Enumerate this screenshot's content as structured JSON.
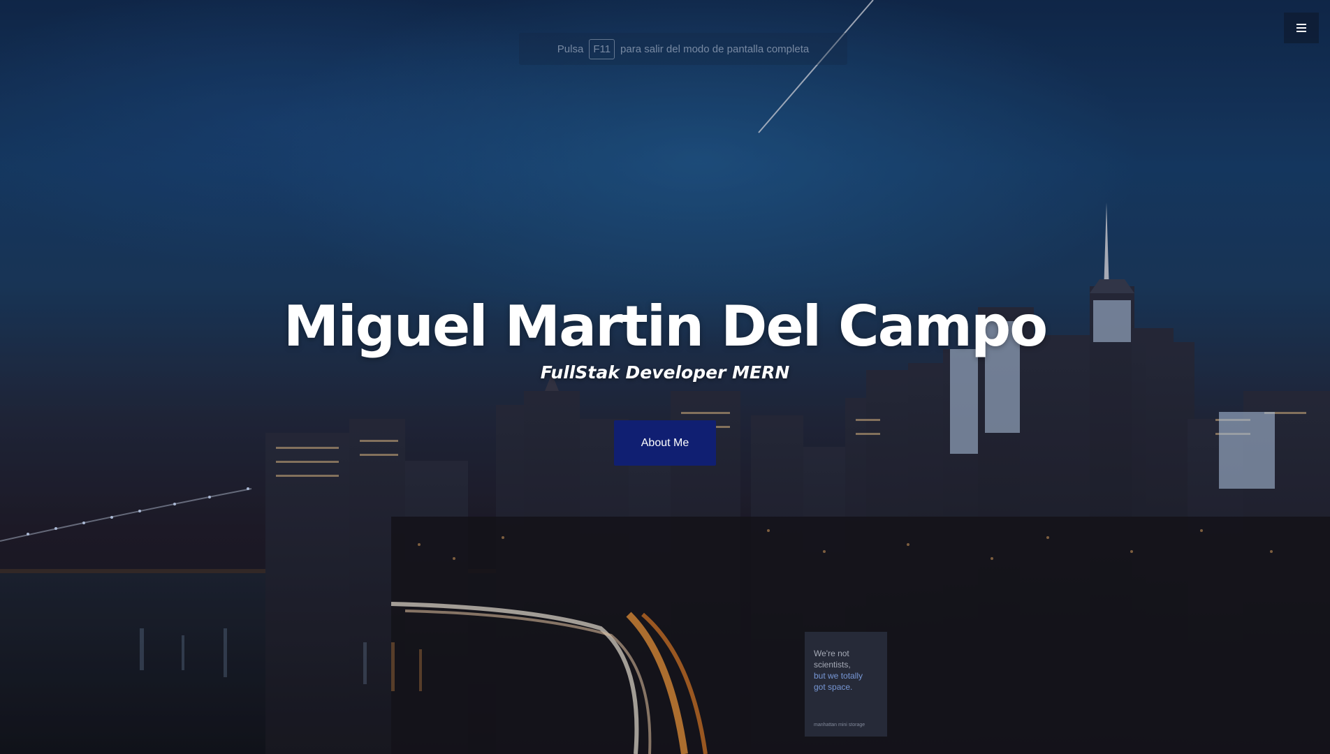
{
  "fullscreen_notice": {
    "before": "Pulsa",
    "key": "F11",
    "after": "para salir del modo de pantalla completa"
  },
  "menu": {
    "icon": "hamburger-menu-icon"
  },
  "hero": {
    "title": "Miguel Martin Del Campo",
    "subtitle": "FullStak Developer MERN",
    "button_label": "About Me",
    "button_color": "#101f72"
  },
  "background": {
    "billboard_lines": [
      "We're not",
      "scientists,",
      "but we totally",
      "got space."
    ],
    "billboard_brand": "manhattan mini storage"
  }
}
